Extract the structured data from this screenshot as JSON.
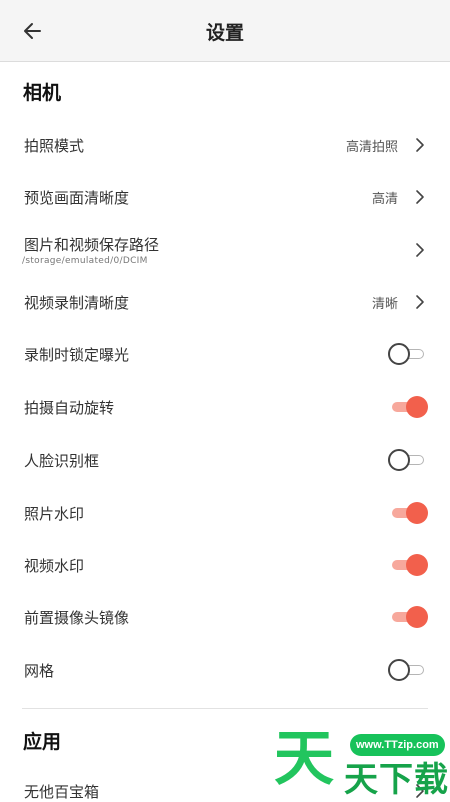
{
  "header": {
    "title": "设置",
    "back_icon": "arrow-left-icon"
  },
  "camera_section": {
    "title": "相机"
  },
  "items": [
    {
      "label": "拍照模式",
      "value": "高清拍照",
      "type": "nav"
    },
    {
      "label": "预览画面清晰度",
      "value": "高清",
      "type": "nav"
    },
    {
      "label": "图片和视频保存路径",
      "subtext": "/storage/emulated/0/DCIM",
      "type": "nav"
    },
    {
      "label": "视频录制清晰度",
      "value": "清晰",
      "type": "nav"
    },
    {
      "label": "录制时锁定曝光",
      "type": "toggle",
      "checked": false
    },
    {
      "label": "拍摄自动旋转",
      "type": "toggle",
      "checked": true
    },
    {
      "label": "人脸识别框",
      "type": "toggle",
      "checked": false
    },
    {
      "label": "照片水印",
      "type": "toggle",
      "checked": true
    },
    {
      "label": "视频水印",
      "type": "toggle",
      "checked": true
    },
    {
      "label": "前置摄像头镜像",
      "type": "toggle",
      "checked": true
    },
    {
      "label": "网格",
      "type": "toggle",
      "checked": false
    }
  ],
  "app_section": {
    "title": "应用",
    "items": [
      {
        "label": "无他百宝箱",
        "type": "nav"
      }
    ]
  },
  "watermark": {
    "url": "www.TTzip.com",
    "logo": "天",
    "text": "天下载"
  },
  "colors": {
    "accent": "#f2604c",
    "accent_track": "#f7a89c",
    "header_bg": "#f5f5f5",
    "watermark_green": "#22c55e"
  }
}
